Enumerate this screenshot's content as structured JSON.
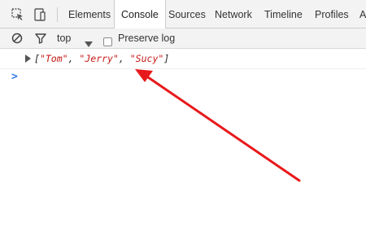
{
  "tabs": [
    {
      "label": "Elements"
    },
    {
      "label": "Console"
    },
    {
      "label": "Sources"
    },
    {
      "label": "Network"
    },
    {
      "label": "Timeline"
    },
    {
      "label": "Profiles"
    },
    {
      "label": "A"
    }
  ],
  "active_tab": "Console",
  "toolbar": {
    "context_value": "top",
    "preserve_log_label": "Preserve log",
    "preserve_log_checked": false
  },
  "console": {
    "log_open": "[",
    "log_items": [
      "\"Tom\"",
      "\"Jerry\"",
      "\"Sucy\""
    ],
    "log_sep": ", ",
    "log_close": "]",
    "prompt_symbol": ">"
  },
  "colors": {
    "string_value": "#c41a16",
    "prompt": "#367cf1",
    "annotation_arrow": "#e8191b"
  },
  "icons": {
    "inspect": "inspect-element-icon",
    "device": "device-mode-icon",
    "clear": "clear-console-icon",
    "filter": "filter-icon",
    "dropdown": "dropdown-triangle-icon",
    "expand": "expand-triangle-icon"
  }
}
